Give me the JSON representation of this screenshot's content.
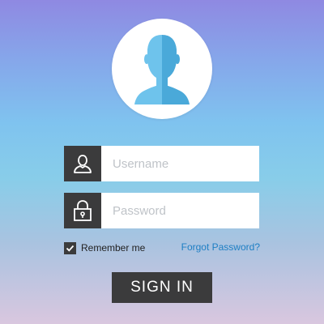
{
  "username_field": {
    "placeholder": "Username",
    "icon": "user-icon"
  },
  "password_field": {
    "placeholder": "Password",
    "icon": "lock-icon"
  },
  "remember": {
    "label": "Remember me",
    "checked": true
  },
  "forgot_password": {
    "label": "Forgot Password?"
  },
  "sign_in": {
    "label": "SIGN IN"
  },
  "avatar": {
    "icon": "user-avatar-icon"
  },
  "colors": {
    "dark": "#3b3b3c",
    "link": "#1e7fc4",
    "avatar_light": "#6ec3ec",
    "avatar_dark": "#4aa9d9"
  }
}
